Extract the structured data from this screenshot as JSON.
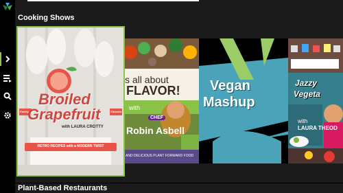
{
  "rows": [
    {
      "title": "Cooking Shows"
    },
    {
      "title": "Plant-Based Restaurants"
    }
  ],
  "shows": [
    {
      "title_line1": "Broiled",
      "title_line2": "Grapefruit",
      "host": "with LAURA CROTTY",
      "ribbon": "RETRO RECIPES with a MODERN TWIST",
      "side_left": "Family",
      "side_right": "Classics"
    },
    {
      "title_line1": "s all about",
      "title_line2": "FLAVOR!",
      "with_label": "with",
      "chef_badge": "CHEF",
      "host": "Robin Asbell",
      "tagline": "AND DELICIOUS PLANT FORWARD FOOD"
    },
    {
      "title_line1": "Vegan",
      "title_line2": "Mashup"
    },
    {
      "title_line1": "Jazzy",
      "title_line2": "Vegeta",
      "with_label": "with",
      "host": "LAURA THEOD"
    }
  ],
  "colors": {
    "accent": "#8bc34a",
    "sidebar": "#000000",
    "background": "#1b1b1b"
  },
  "icons": [
    "app-logo-icon",
    "chevron-right-icon",
    "queue-list-icon",
    "search-icon",
    "gear-icon"
  ]
}
